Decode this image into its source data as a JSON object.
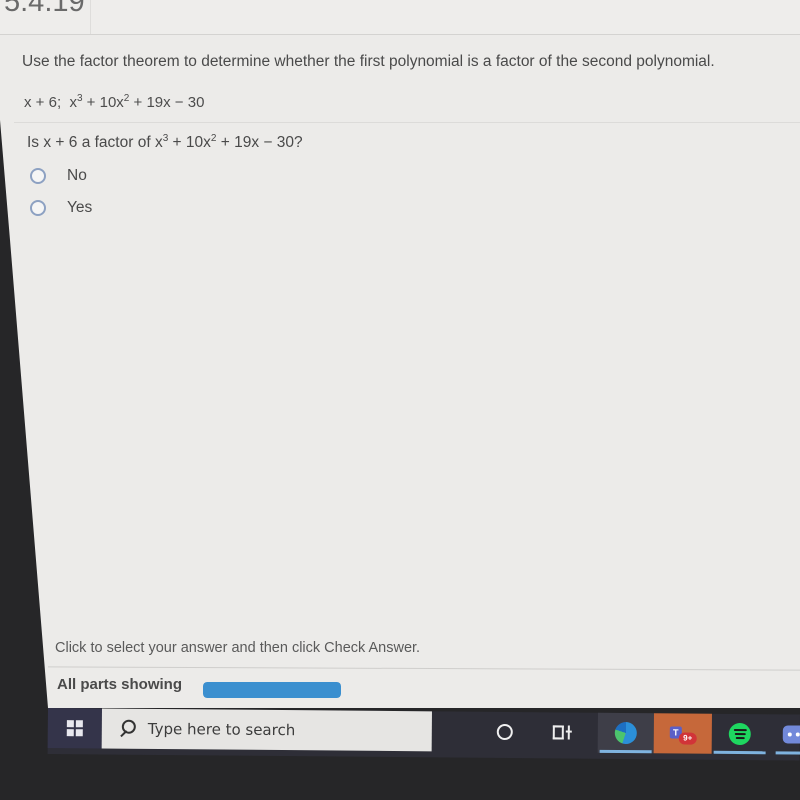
{
  "header": {
    "problem_number": "5.4.19"
  },
  "problem": {
    "instruction": "Use the factor theorem to determine whether the first polynomial is a factor of the second polynomial.",
    "first_polynomial": "x + 6",
    "separator": ";",
    "second_polynomial_parts": [
      "x",
      "3",
      " + 10x",
      "2",
      " + 19x − 30"
    ]
  },
  "question": {
    "prefix": "Is x + 6 a factor of ",
    "poly_parts": [
      "x",
      "3",
      " + 10x",
      "2",
      " + 19x − 30"
    ],
    "suffix": "?",
    "options": [
      {
        "label": "No",
        "selected": false
      },
      {
        "label": "Yes",
        "selected": false
      }
    ]
  },
  "footer": {
    "hint": "Click to select your answer and then click Check Answer.",
    "parts_label": "All parts showing",
    "progress_fraction": 1.0,
    "progress_color": "#3b8fcf"
  },
  "taskbar": {
    "start_icon": "windows-logo-icon",
    "search_placeholder": "Type here to search",
    "apps": [
      {
        "name": "Cortana",
        "icon": "cortana-icon"
      },
      {
        "name": "Task View",
        "icon": "task-view-icon"
      },
      {
        "name": "Microsoft Edge",
        "icon": "edge-icon",
        "running": true
      },
      {
        "name": "Microsoft Teams",
        "icon": "teams-icon",
        "badge": "9+",
        "active": true,
        "accent": "#c6683a"
      },
      {
        "name": "Spotify",
        "icon": "spotify-icon",
        "running": true
      },
      {
        "name": "Discord",
        "icon": "discord-icon",
        "running": true
      }
    ],
    "teams_initial": "T"
  }
}
